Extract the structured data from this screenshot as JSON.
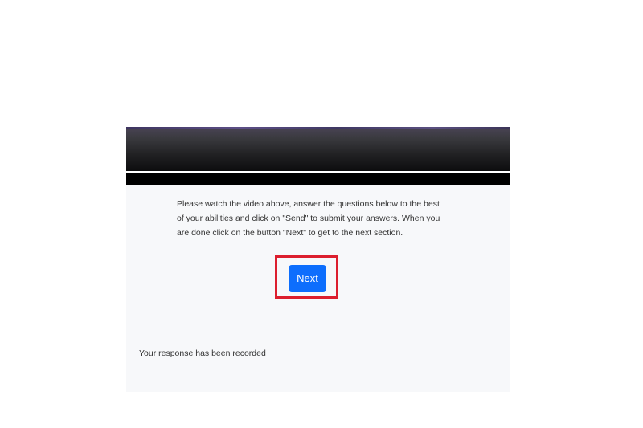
{
  "survey": {
    "instructions": "Please watch the video above, answer the questions below to the best of your abilities and click on \"Send\" to submit your answers. When you are done click on the button \"Next\" to get to the next section.",
    "next_label": "Next",
    "status_text": "Your response has been recorded"
  },
  "colors": {
    "primary_button": "#0d6efd",
    "highlight_border": "#dc1e2e",
    "card_background": "#f7f8fa"
  }
}
